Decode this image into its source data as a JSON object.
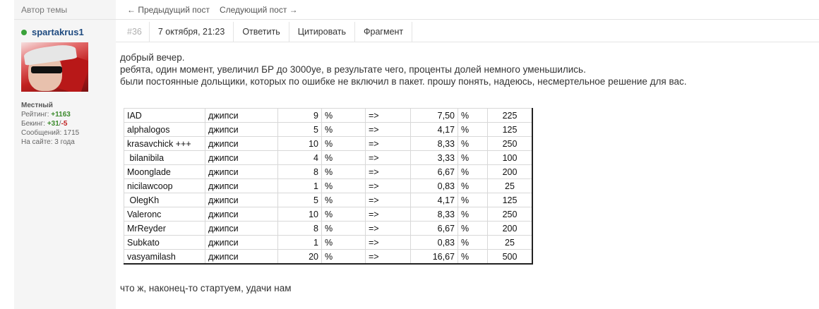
{
  "sidebar": {
    "header": "Автор темы",
    "username": "spartakrus1",
    "rank": "Местный",
    "rating_label": "Рейтинг: ",
    "rating_value": "+1163",
    "backing_label": "Бекинг: ",
    "backing_pos": "+31",
    "backing_sep": "/",
    "backing_neg": "-5",
    "messages": "Сообщений: 1715",
    "on_site": "На сайте: 3 года",
    "online_color": "#3aa23a"
  },
  "nav": {
    "prev": "← Предыдущий пост",
    "next": "Следующий пост →"
  },
  "post": {
    "number": "#36",
    "date": "7 октября, 21:23",
    "reply": "Ответить",
    "quote": "Цитировать",
    "fragment": "Фрагмент",
    "lines": [
      "добрый вечер.",
      "ребята, один момент, увеличил БР до 3000уе, в результате чего, проценты долей немного уменьшились.",
      "были постоянные дольщики, которых по ошибке не включил в пакет. прошу понять, надеюсь, несмертельное решение для вас."
    ],
    "closing": "что ж, наконец-то стартуем, удачи нам"
  },
  "table": {
    "rows": [
      {
        "name": "IAD",
        "type": "джипси",
        "pct": "9",
        "sign": "%",
        "arrow": "=>",
        "new": "7,50",
        "sign2": "%",
        "amount": "225"
      },
      {
        "name": "alphalogos",
        "type": "джипси",
        "pct": "5",
        "sign": "%",
        "arrow": "=>",
        "new": "4,17",
        "sign2": "%",
        "amount": "125"
      },
      {
        "name": "krasavchick +++",
        "type": "джипси",
        "pct": "10",
        "sign": "%",
        "arrow": "=>",
        "new": "8,33",
        "sign2": "%",
        "amount": "250"
      },
      {
        "name": " bilanibila",
        "type": "джипси",
        "pct": "4",
        "sign": "%",
        "arrow": "=>",
        "new": "3,33",
        "sign2": "%",
        "amount": "100"
      },
      {
        "name": "Moonglade",
        "type": "джипси",
        "pct": "8",
        "sign": "%",
        "arrow": "=>",
        "new": "6,67",
        "sign2": "%",
        "amount": "200"
      },
      {
        "name": "nicilawcoop",
        "type": "джипси",
        "pct": "1",
        "sign": "%",
        "arrow": "=>",
        "new": "0,83",
        "sign2": "%",
        "amount": "25"
      },
      {
        "name": " OlegKh",
        "type": "джипси",
        "pct": "5",
        "sign": "%",
        "arrow": "=>",
        "new": "4,17",
        "sign2": "%",
        "amount": "125"
      },
      {
        "name": "Valeronc",
        "type": "джипси",
        "pct": "10",
        "sign": "%",
        "arrow": "=>",
        "new": "8,33",
        "sign2": "%",
        "amount": "250"
      },
      {
        "name": "MrReyder",
        "type": "джипси",
        "pct": "8",
        "sign": "%",
        "arrow": "=>",
        "new": "6,67",
        "sign2": "%",
        "amount": "200"
      },
      {
        "name": "Subkato",
        "type": "джипси",
        "pct": "1",
        "sign": "%",
        "arrow": "=>",
        "new": "0,83",
        "sign2": "%",
        "amount": "25"
      },
      {
        "name": "vasyamilash",
        "type": "джипси",
        "pct": "20",
        "sign": "%",
        "arrow": "=>",
        "new": "16,67",
        "sign2": "%",
        "amount": "500"
      }
    ]
  }
}
